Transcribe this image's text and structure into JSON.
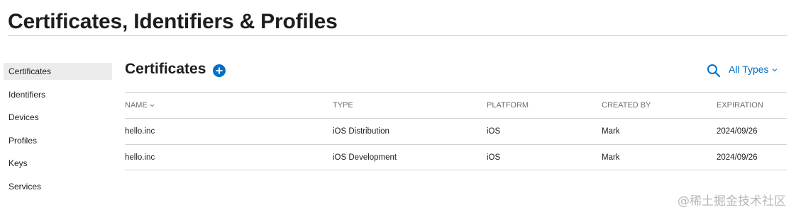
{
  "header": {
    "title": "Certificates, Identifiers & Profiles"
  },
  "sidebar": {
    "items": [
      {
        "label": "Certificates",
        "active": true
      },
      {
        "label": "Identifiers"
      },
      {
        "label": "Devices"
      },
      {
        "label": "Profiles"
      },
      {
        "label": "Keys"
      },
      {
        "label": "Services"
      }
    ]
  },
  "main": {
    "section_title": "Certificates",
    "add_icon": "plus-circle-icon",
    "search_icon": "search-icon",
    "filter": {
      "label": "All Types",
      "icon": "chevron-down-icon"
    },
    "table": {
      "columns": [
        "NAME",
        "TYPE",
        "PLATFORM",
        "CREATED BY",
        "EXPIRATION"
      ],
      "sorted_column_icon": "chevron-down-icon",
      "rows": [
        [
          "hello.inc",
          "iOS Distribution",
          "iOS",
          "Mark",
          "2024/09/26"
        ],
        [
          "hello.inc",
          "iOS Development",
          "iOS",
          "Mark",
          "2024/09/26"
        ]
      ]
    }
  },
  "watermark": "@稀土掘金技术社区",
  "colors": {
    "accent": "#0070c9",
    "text": "#1d1d1f",
    "muted": "#6e6e73",
    "divider": "#d2d2d7",
    "active_bg": "#ececec"
  }
}
